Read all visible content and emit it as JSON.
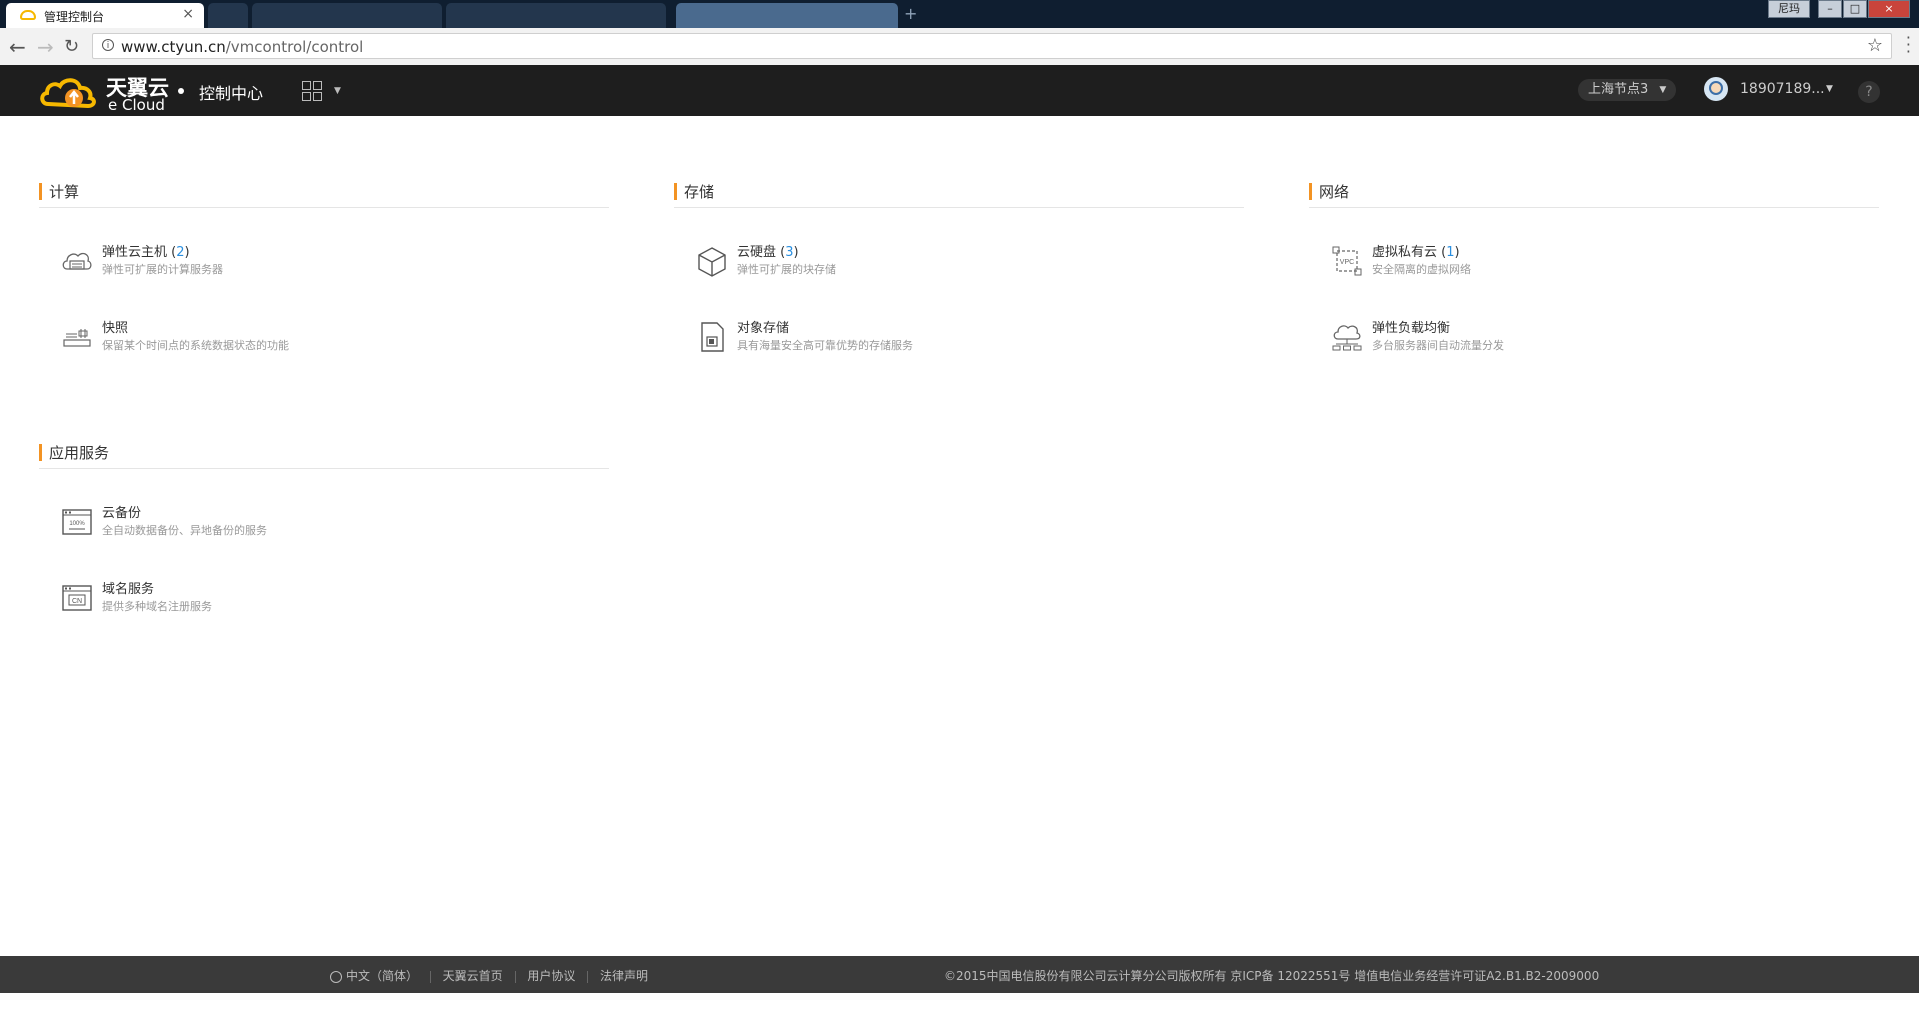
{
  "browser": {
    "active_tab_title": "管理控制台",
    "user_badge": "尼玛",
    "url_host": "www.ctyun.cn",
    "url_path": "/vmcontrol/control"
  },
  "header": {
    "logo_cn": "天翼云",
    "logo_en": "e Cloud",
    "title": "控制中心",
    "region": "上海节点3",
    "user": "18907189...",
    "help": "?"
  },
  "sections": {
    "compute": {
      "title": "计算",
      "items": [
        {
          "name": "弹性云主机",
          "count": "2",
          "desc": "弹性可扩展的计算服务器",
          "icon": "cloud-server-icon"
        },
        {
          "name": "快照",
          "desc": "保留某个时间点的系统数据状态的功能",
          "icon": "snapshot-icon"
        }
      ]
    },
    "storage": {
      "title": "存储",
      "items": [
        {
          "name": "云硬盘",
          "count": "3",
          "desc": "弹性可扩展的块存储",
          "icon": "cube-icon"
        },
        {
          "name": "对象存储",
          "desc": "具有海量安全高可靠优势的存储服务",
          "icon": "object-storage-icon"
        }
      ]
    },
    "network": {
      "title": "网络",
      "items": [
        {
          "name": "虚拟私有云",
          "count": "1",
          "desc": "安全隔离的虚拟网络",
          "icon": "vpc-icon",
          "icon_text": "VPC"
        },
        {
          "name": "弹性负载均衡",
          "desc": "多台服务器间自动流量分发",
          "icon": "load-balancer-icon"
        }
      ]
    },
    "apps": {
      "title": "应用服务",
      "items": [
        {
          "name": "云备份",
          "desc": "全自动数据备份、异地备份的服务",
          "icon": "backup-icon",
          "icon_text": "100%"
        },
        {
          "name": "域名服务",
          "desc": "提供多种域名注册服务",
          "icon": "domain-icon",
          "icon_text": "CN"
        }
      ]
    }
  },
  "footer": {
    "language": "中文（简体）",
    "links": [
      "天翼云首页",
      "用户协议",
      "法律声明"
    ],
    "copyright": "©2015中国电信股份有限公司云计算分公司版权所有 京ICP备 12022551号  增值电信业务经营许可证A2.B1.B2-2009000"
  }
}
